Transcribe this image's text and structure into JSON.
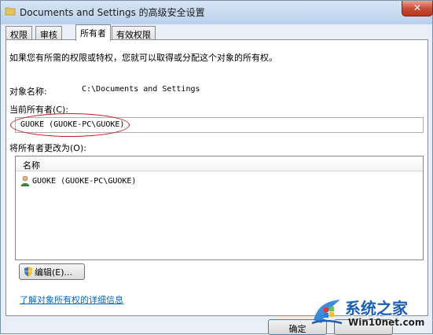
{
  "window": {
    "title": "Documents and Settings 的高级安全设置",
    "close_glyph": "✕"
  },
  "tabs": [
    {
      "label": "权限"
    },
    {
      "label": "审核"
    },
    {
      "label": "所有者"
    },
    {
      "label": "有效权限"
    }
  ],
  "active_tab": "所有者",
  "owner_tab": {
    "intro": "如果您有所需的权限或特权，您就可以取得或分配这个对象的所有权。",
    "object_name_label": "对象名称:",
    "object_name_value": "C:\\Documents and Settings",
    "current_owner_label": "当前所有者(C):",
    "current_owner_value": "GUOKE (GUOKE-PC\\GUOKE)",
    "change_owner_label": "将所有者更改为(O):",
    "list": {
      "header": "名称",
      "rows": [
        {
          "icon": "user-icon",
          "name": "GUOKE (GUOKE-PC\\GUOKE)"
        }
      ]
    },
    "edit_button": "编辑(E)...",
    "learn_link": "了解对象所有权的详细信息"
  },
  "footer": {
    "ok_button": "确定"
  },
  "watermark": {
    "brand": "系统之家",
    "site": "Win10net.com"
  },
  "colors": {
    "highlight_oval": "#c9191e",
    "link": "#0066cc",
    "watermark_blue": "#1d5fb5"
  }
}
